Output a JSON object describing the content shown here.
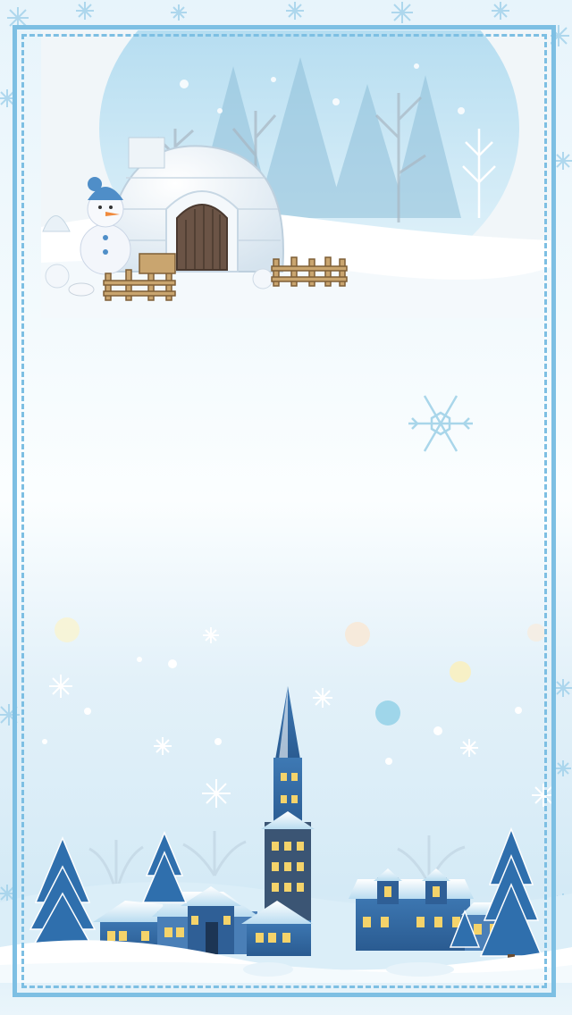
{
  "theme": {
    "frame_color": "#7dbfe3",
    "sky_color": "#bfe2f2",
    "snow_color": "#ffffff",
    "house_roof": "#4b8fc9",
    "window_light": "#f4d36a"
  },
  "decorations": {
    "top_scene": [
      "igloo",
      "snowman",
      "wooden-fence",
      "snow-trees"
    ],
    "bottom_scene": [
      "village",
      "church-tower",
      "pine-trees",
      "snowflakes"
    ]
  }
}
